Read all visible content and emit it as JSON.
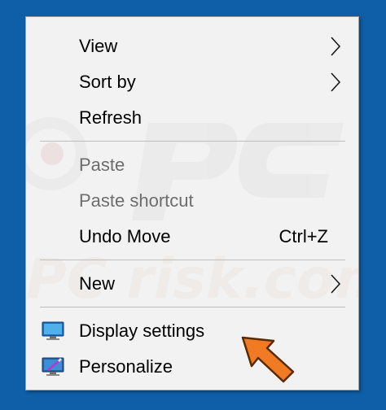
{
  "menu": {
    "items": [
      {
        "label": "View"
      },
      {
        "label": "Sort by"
      },
      {
        "label": "Refresh"
      },
      {
        "label": "Paste"
      },
      {
        "label": "Paste shortcut"
      },
      {
        "label": "Undo Move",
        "shortcut": "Ctrl+Z"
      },
      {
        "label": "New"
      },
      {
        "label": "Display settings",
        "icon": "display-settings-icon"
      },
      {
        "label": "Personalize",
        "icon": "personalize-icon"
      }
    ]
  },
  "watermark": {
    "text": "PC risk.com"
  },
  "colors": {
    "desktop": "#0f5fa8",
    "menu_bg": "#f2f2f2",
    "disabled_text": "#6d6d6d",
    "pointer_arrow": "#f07b22"
  }
}
